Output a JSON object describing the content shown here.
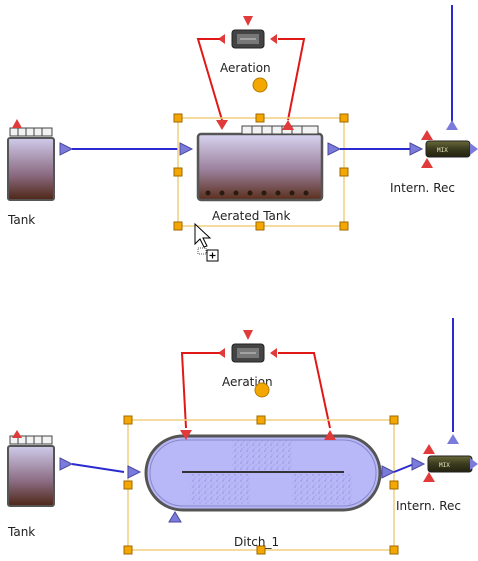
{
  "scene_top": {
    "left_tank_label": "Tank",
    "aeration_label": "Aeration",
    "selected_label": "Aerated Tank",
    "right_label": "Intern. Rec",
    "recycle_badge": "MIX"
  },
  "scene_bottom": {
    "left_tank_label": "Tank",
    "aeration_label": "Aeration",
    "selected_label": "Ditch_1",
    "right_label": "Intern. Rec",
    "recycle_badge": "MIX"
  },
  "colors": {
    "pipe_blue": "#2a2ad0",
    "air_red": "#e01818",
    "port_red": "#e03a3a",
    "port_blue": "#7b7bdc",
    "handle_orange": "#f4a700",
    "selection_frame": "#f0d080",
    "sludge_brown": "#6a3a22",
    "ditch_fill": "#b8b8f8"
  },
  "icons": [
    "cursor-arrow-icon",
    "copy-plus-icon",
    "blower-icon",
    "valve-icon"
  ]
}
